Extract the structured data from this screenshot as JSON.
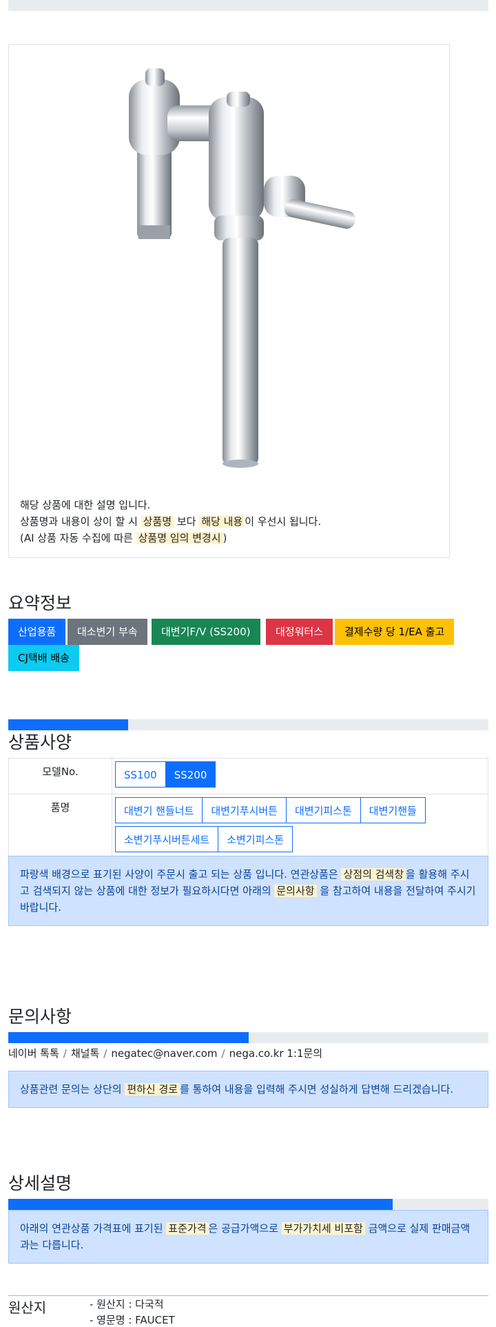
{
  "photo": {
    "desc_line1": "해당 상품에 대한 설명 입니다.",
    "desc_line2_a": "상품명과 내용이 상이 할 시",
    "desc_line2_hl1": "상품명",
    "desc_line2_b": "보다",
    "desc_line2_hl2": "해당 내용",
    "desc_line2_c": "이 우선시 됩니다.",
    "desc_line3_a": "(AI 상품 자동 수집에 따른",
    "desc_line3_hl": "상품명 임의 변경시",
    "desc_line3_b": ")"
  },
  "summary": {
    "title": "요약정보",
    "badges": [
      {
        "label": "산업용품",
        "color": "#0d6efd",
        "text_color": "#ffffff"
      },
      {
        "label": "대소변기 부속",
        "color": "#6c757d",
        "text_color": "#ffffff"
      },
      {
        "label": "대변기F/V (SS200)",
        "color": "#198754",
        "text_color": "#ffffff"
      },
      {
        "label": "대정워터스",
        "color": "#dc3545",
        "text_color": "#ffffff"
      },
      {
        "label": "결제수량 당 1/EA 출고",
        "color": "#ffc107",
        "text_color": "#000000"
      },
      {
        "label": "CJ택배 배송",
        "color": "#0dcaf0",
        "text_color": "#000000"
      }
    ]
  },
  "spec": {
    "title": "상품사양",
    "progress": 0.25,
    "model_label": "모델No.",
    "models": [
      {
        "label": "SS100",
        "active": false
      },
      {
        "label": "SS200",
        "active": true
      }
    ],
    "name_label": "품명",
    "names": [
      "대변기 핸들너트",
      "대변기푸시버튼",
      "대변기피스톤",
      "대변기핸들",
      "소변기푸시버튼세트",
      "소변기피스톤"
    ],
    "notice_a": "파랑색 배경으로 표기된 사양이 주문시 출고 되는 상품 입니다. 연관상품은",
    "notice_hl1": "상점의 검색창",
    "notice_b": "을 활용해 주시고 검색되지 않는 상품에 대한 정보가 필요하시다면 아래의",
    "notice_hl2": "문의사항",
    "notice_c": "을 참고하여 내용을 전달하여 주시기 바랍니다."
  },
  "inquiry": {
    "title": "문의사항",
    "progress": 0.5,
    "channels": [
      "네이버 톡톡",
      "채널톡",
      "negatec@naver.com",
      "nega.co.kr 1:1문의"
    ],
    "notice_a": "상품관련 문의는 상단의",
    "notice_hl": "편하신 경로",
    "notice_b": "를 통하여 내용을 입력해 주시면 성실하게 답변해 드리겠습니다."
  },
  "detail": {
    "title": "상세설명",
    "progress": 0.8,
    "notice_a": "아래의 연관상품 가격표에 표기된",
    "notice_hl1": "표준가격",
    "notice_b": "은 공급가액으로",
    "notice_hl2": "부가가치세 비포함",
    "notice_c": "금액으로 실제 판매금액과는 다릅니다."
  },
  "origin": {
    "title": "원산지",
    "line1": "- 원산지 : 다국적",
    "line2": "- 영문명 : FAUCET"
  }
}
